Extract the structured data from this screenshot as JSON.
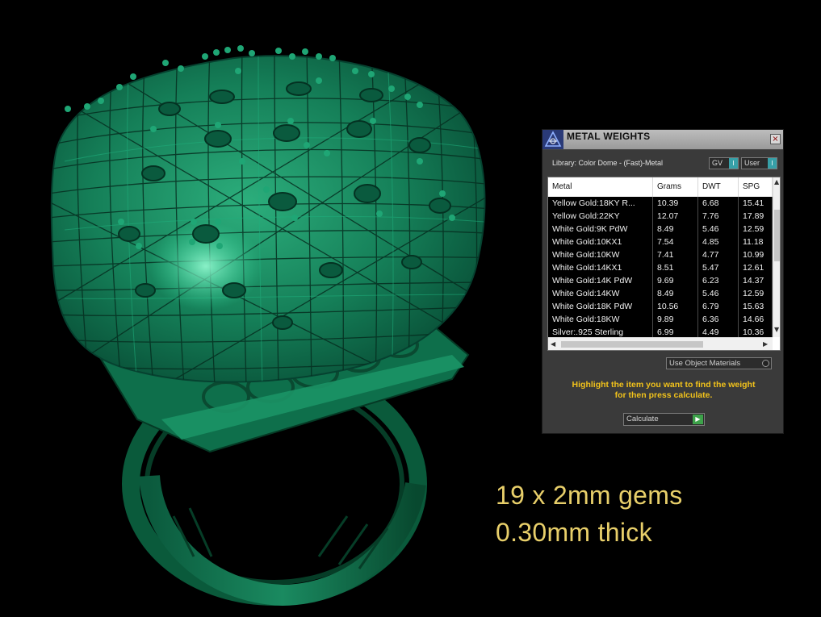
{
  "scene": {
    "object": "green wireframe dome ring",
    "colors": {
      "background": "#000000",
      "ring": "#0d6b4a",
      "highlight": "#2fd79a",
      "caption": "#e8cf6a"
    }
  },
  "caption": {
    "line1": "19 x 2mm gems",
    "line2": "0.30mm thick"
  },
  "panel": {
    "title": "METAL WEIGHTS",
    "logo_icon": "app-logo-icon",
    "close_label": "×",
    "library": "Library: Color Dome - (Fast)-Metal",
    "gv_label": "GV",
    "user_label": "User",
    "toggle_knob": "I",
    "columns": [
      "Metal",
      "Grams",
      "DWT",
      "SPG"
    ],
    "rows": [
      [
        "Yellow Gold:18KY R...",
        "10.39",
        "6.68",
        "15.41"
      ],
      [
        "Yellow Gold:22KY",
        "12.07",
        "7.76",
        "17.89"
      ],
      [
        "White Gold:9K PdW",
        "8.49",
        "5.46",
        "12.59"
      ],
      [
        "White Gold:10KX1",
        "7.54",
        "4.85",
        "11.18"
      ],
      [
        "White Gold:10KW",
        "7.41",
        "4.77",
        "10.99"
      ],
      [
        "White Gold:14KX1",
        "8.51",
        "5.47",
        "12.61"
      ],
      [
        "White Gold:14K PdW",
        "9.69",
        "6.23",
        "14.37"
      ],
      [
        "White Gold:14KW",
        "8.49",
        "5.46",
        "12.59"
      ],
      [
        "White Gold:18K PdW",
        "10.56",
        "6.79",
        "15.63"
      ],
      [
        "White Gold:18KW",
        "9.89",
        "6.36",
        "14.66"
      ],
      [
        "Silver:.925 Sterling",
        "6.99",
        "4.49",
        "10.36"
      ]
    ],
    "use_object_materials": "Use Object Materials",
    "hint_line1": "Highlight the item you want to find the weight",
    "hint_line2": "for then press calculate.",
    "calculate_label": "Calculate",
    "colors": {
      "panel_bg": "#3a3a3a",
      "toggle_accent": "#37a0a8",
      "hint": "#f1c21b",
      "play": "#3da24a"
    }
  }
}
